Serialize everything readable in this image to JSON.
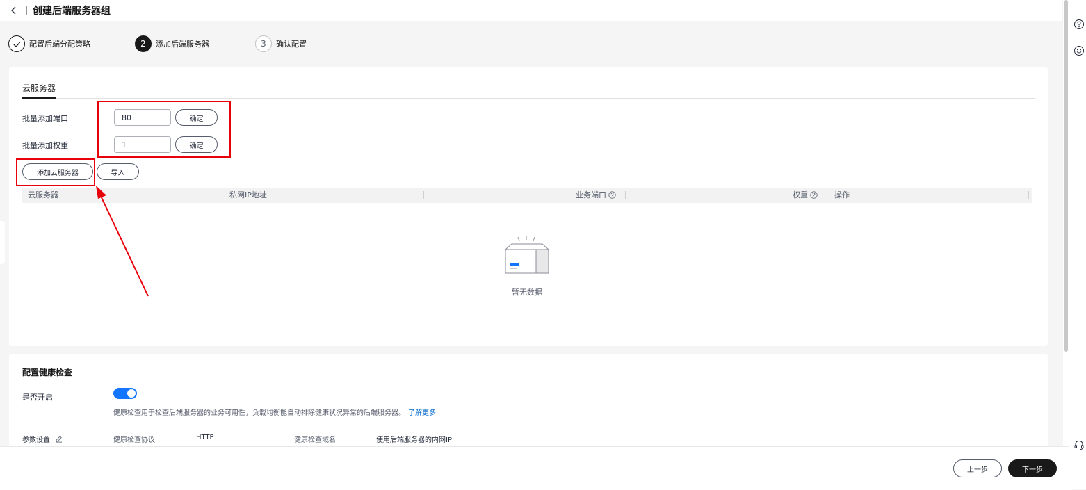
{
  "header": {
    "title": "创建后端服务器组"
  },
  "steps": [
    {
      "number": "1",
      "label": "配置后端分配策略",
      "state": "done"
    },
    {
      "number": "2",
      "label": "添加后端服务器",
      "state": "active"
    },
    {
      "number": "3",
      "label": "确认配置",
      "state": "todo"
    }
  ],
  "servers": {
    "tab": "云服务器",
    "batch_port_label": "批量添加端口",
    "batch_port_value": "80",
    "batch_weight_label": "批量添加权重",
    "batch_weight_value": "1",
    "confirm_label": "确定",
    "add_button": "添加云服务器",
    "import_button": "导入",
    "columns": [
      "云服务器",
      "私网IP地址",
      "业务端口",
      "权重",
      "操作"
    ],
    "empty_text": "暂无数据"
  },
  "health_check": {
    "title": "配置健康检查",
    "enable_label": "是否开启",
    "enabled": true,
    "description": "健康检查用于检查后端服务器的业务可用性，负载均衡能自动排除健康状况异常的后端服务器。",
    "learn_more": "了解更多",
    "params_label": "参数设置",
    "protocol_label": "健康检查协议",
    "protocol_value": "HTTP",
    "domain_label": "健康检查域名",
    "domain_value": "使用后端服务器的内网IP"
  },
  "footer": {
    "prev": "上一步",
    "next": "下一步"
  },
  "colors": {
    "accent": "#1476ff",
    "primary_dark": "#191919",
    "annotation": "#e8000b",
    "link": "#0066cc"
  },
  "icons": [
    "chevron-left-icon",
    "check-icon",
    "question-icon",
    "empty-box-icon",
    "edit-icon",
    "help-icon",
    "smiley-icon",
    "headset-icon"
  ]
}
